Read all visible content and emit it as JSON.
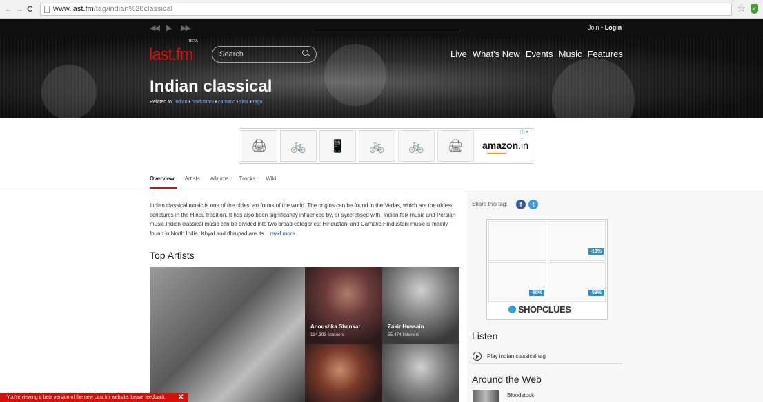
{
  "browser": {
    "url_host": "www.last.fm",
    "url_path": "/tag/indian%20classical"
  },
  "header": {
    "auth_join": "Join",
    "auth_sep": "•",
    "auth_login": "Login",
    "logo": "last.fm",
    "logo_badge": "BETA",
    "search_placeholder": "Search",
    "nav": [
      "Live",
      "What's New",
      "Events",
      "Music",
      "Features"
    ]
  },
  "tag": {
    "title": "Indian classical",
    "related_label": "Related to",
    "related": [
      "indian",
      "hindustani",
      "carnatic",
      "sitar",
      "raga"
    ]
  },
  "ad": {
    "brand": "amazon",
    "brand_suffix": ".in"
  },
  "tabs": [
    "Overview",
    "Artists",
    "Albums",
    "Tracks",
    "Wiki"
  ],
  "overview": {
    "description": "Indian classical music is one of the oldest art forms of the world. The origins can be found in the Vedas, which are the oldest scriptures in the Hindu tradition. It has also been significantly influenced by, or syncretised with, Indian folk music and Persian music.Indian classical music can be divided into two broad categories: Hindustani and Carnatic.Hindustani music is mainly found in North India. Khyal and dhrupad are its...",
    "read_more": "read more"
  },
  "top_artists": {
    "heading": "Top Artists",
    "items": [
      {
        "name": "Anoushka Shankar",
        "listeners": "114,393 listeners"
      },
      {
        "name": "Zakir Hussain",
        "listeners": "55,474 listeners"
      }
    ]
  },
  "sidebar": {
    "share_label": "Share this tag:",
    "ad2": {
      "discounts": [
        "-19%",
        "-60%",
        "-59%"
      ],
      "brand": "SHOPCLUES"
    },
    "listen_heading": "Listen",
    "play_label": "Play indian classical tag",
    "around_heading": "Around the Web",
    "around_items": [
      "Bloodstock"
    ]
  },
  "beta_bar": {
    "text": "You're viewing a beta version of the new Last.fm website. Leave feedback",
    "close": "✕"
  }
}
